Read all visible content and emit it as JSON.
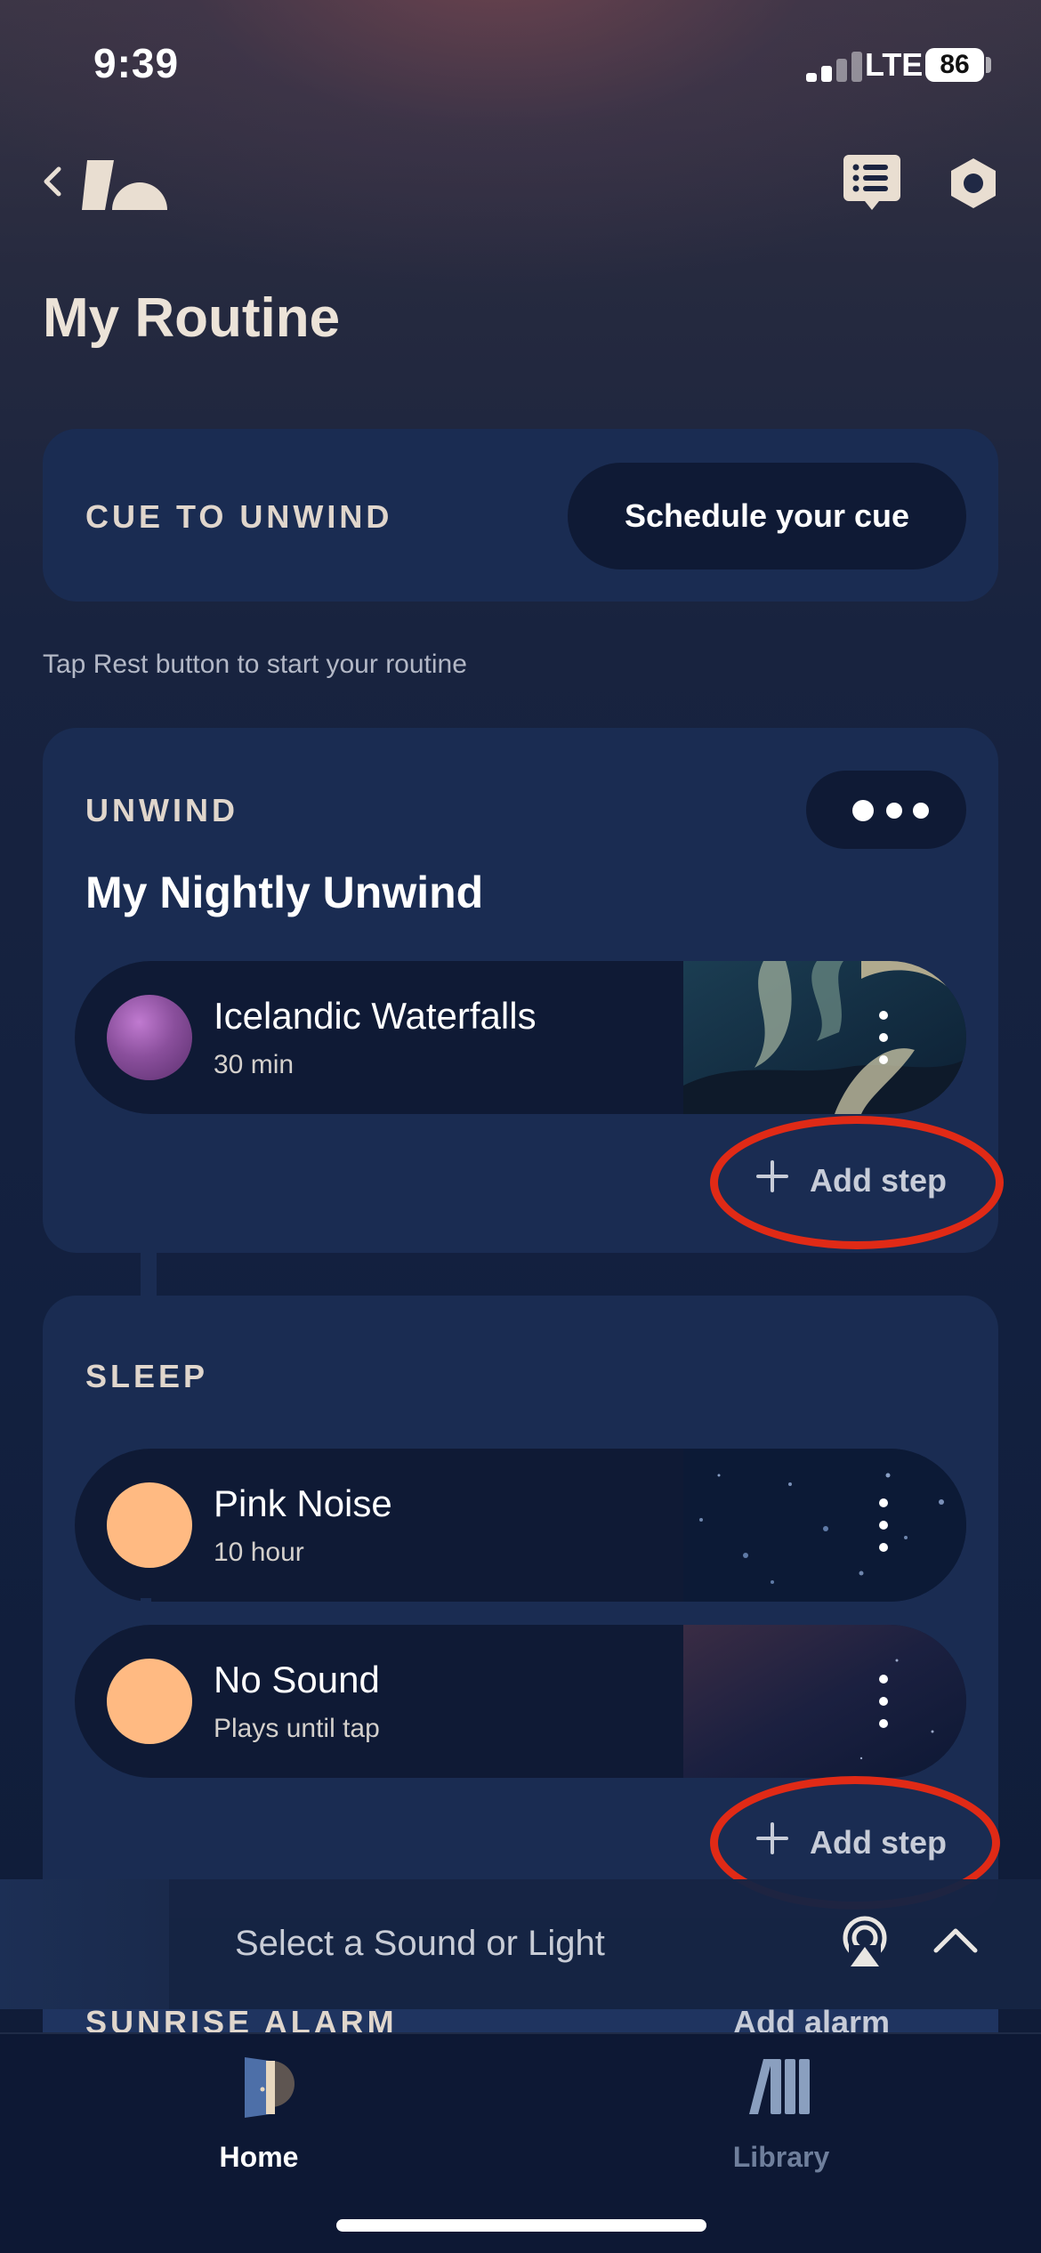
{
  "status_bar": {
    "time": "9:39",
    "network": "LTE",
    "battery": "86"
  },
  "header": {
    "page_title": "My Routine"
  },
  "cue": {
    "label": "CUE TO UNWIND",
    "button_label": "Schedule your cue"
  },
  "hint": "Tap Rest button to start your routine",
  "unwind": {
    "label": "UNWIND",
    "routine_name": "My Nightly Unwind",
    "steps": [
      {
        "title": "Icelandic Waterfalls",
        "subtitle": "30 min",
        "thumb_color": "#8a4f9c"
      }
    ],
    "add_step_label": "Add step"
  },
  "sleep": {
    "label": "SLEEP",
    "steps": [
      {
        "title": "Pink Noise",
        "subtitle": "10 hour",
        "thumb_color": "#ffba82"
      },
      {
        "title": "No Sound",
        "subtitle": "Plays until tap",
        "thumb_color": "#ffba82"
      }
    ],
    "add_step_label": "Add step"
  },
  "mini_player": {
    "prompt": "Select a Sound or Light"
  },
  "sunrise_peek": {
    "label": "SUNRISE ALARM",
    "add_label": "Add alarm"
  },
  "tabs": [
    {
      "label": "Home",
      "active": true
    },
    {
      "label": "Library",
      "active": false
    }
  ],
  "colors": {
    "annotation_ring": "#e02a16",
    "card": "#1a2c52",
    "pill": "#0f1a35"
  }
}
